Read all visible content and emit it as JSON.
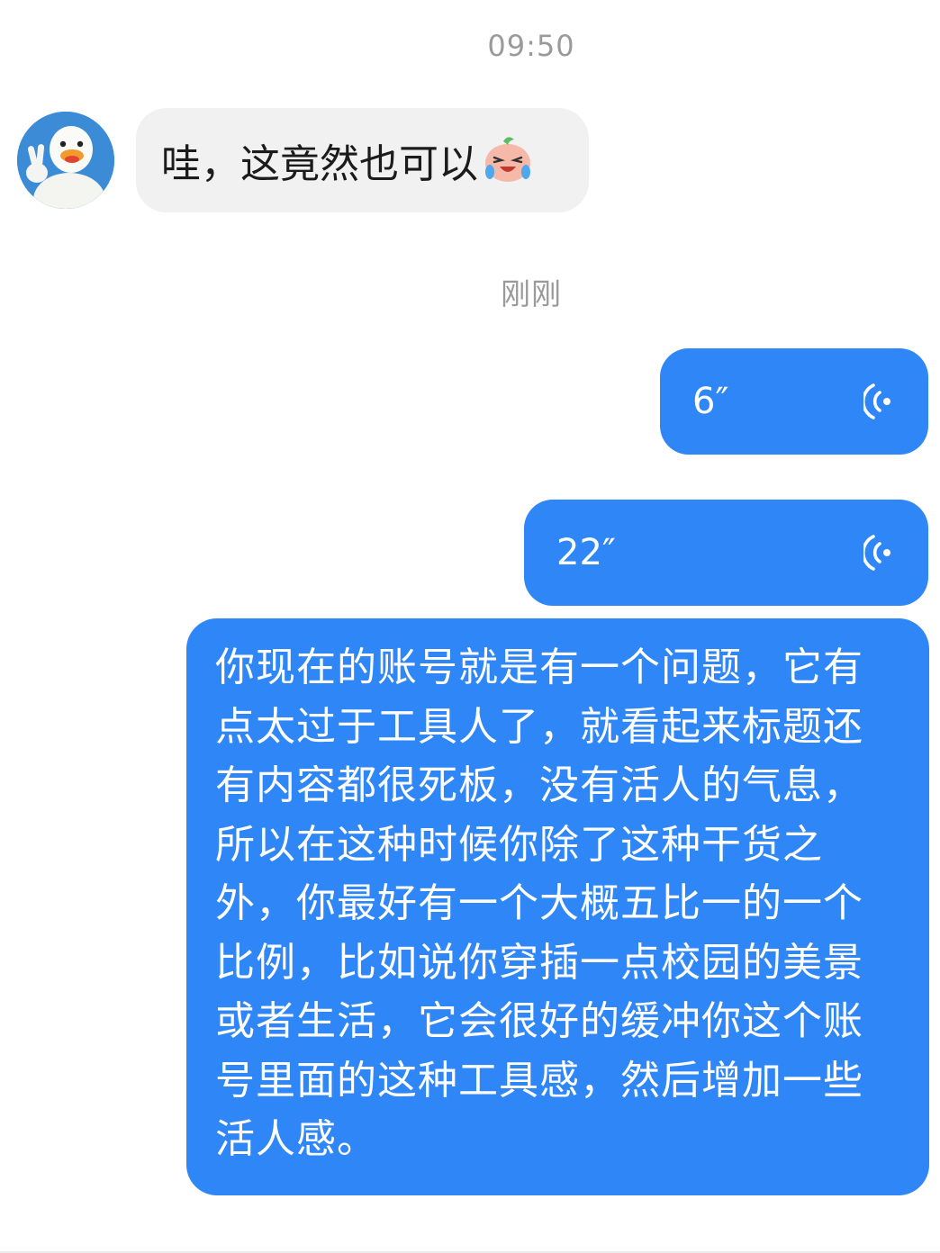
{
  "chat": {
    "timestamp_1": "09:50",
    "timestamp_2": "刚刚",
    "incoming_message": {
      "text": "哇，这竟然也可以",
      "emoji": "laughing-crying-peach-emoji",
      "avatar": "duck-peace-sign-avatar"
    },
    "outgoing_voice_messages": [
      {
        "duration": "6″",
        "icon": "voice-wave-icon"
      },
      {
        "duration": "22″",
        "icon": "voice-wave-icon"
      }
    ],
    "outgoing_text_message": "你现在的账号就是有一个问题，它有点太过于工具人了，就看起来标题还有内容都很死板，没有活人的气息，所以在这种时候你除了这种干货之外，你最好有一个大概五比一的一个比例，比如说你穿插一点校园的美景或者生活，它会很好的缓冲你这个账号里面的这种工具感，然后增加一些活人感。"
  },
  "colors": {
    "outgoing_bubble": "#2f86f6",
    "incoming_bubble": "#f1f1f1",
    "timestamp_text": "#9a9a9a"
  }
}
